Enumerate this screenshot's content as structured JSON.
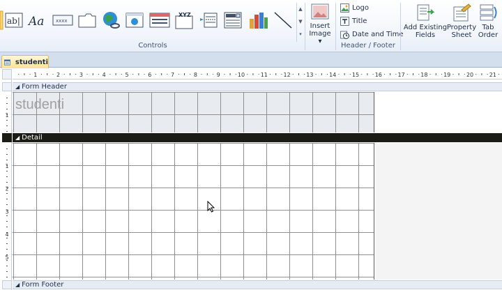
{
  "ribbon": {
    "controls_group_label": "Controls",
    "header_footer_group_label": "Header / Footer",
    "insert_image": {
      "line1": "Insert",
      "line2": "Image"
    },
    "logo_label": "Logo",
    "title_label": "Title",
    "date_time_label": "Date and Time",
    "add_existing_fields": {
      "line1": "Add Existing",
      "line2": "Fields"
    },
    "property_sheet": {
      "line1": "Property",
      "line2": "Sheet"
    },
    "tab_order": {
      "line1": "Tab",
      "line2": "Order"
    },
    "label_control_text": "Aa",
    "textbox_control_text": "ab|",
    "button_control_text": "xxxx",
    "option_group_text": "XYZ"
  },
  "document_tab": {
    "label": "studenti"
  },
  "ruler": {
    "marks": [
      "1",
      "2",
      "3",
      "4",
      "5",
      "6",
      "7",
      "8",
      "9",
      "10",
      "11",
      "12",
      "13",
      "14",
      "15",
      "16",
      "17",
      "18",
      "19",
      "20",
      "21"
    ]
  },
  "vruler": {
    "header_marks": [
      "1"
    ],
    "detail_marks": [
      "1",
      "2",
      "3",
      "4",
      "5"
    ]
  },
  "sections": {
    "form_header": "Form Header",
    "detail": "Detail",
    "form_footer": "Form Footer"
  },
  "form_title": "studenti",
  "colors": {
    "accent": "#fbe29a",
    "detail_bar": "#1c1c16",
    "ribbon": "#f1f5fb"
  }
}
